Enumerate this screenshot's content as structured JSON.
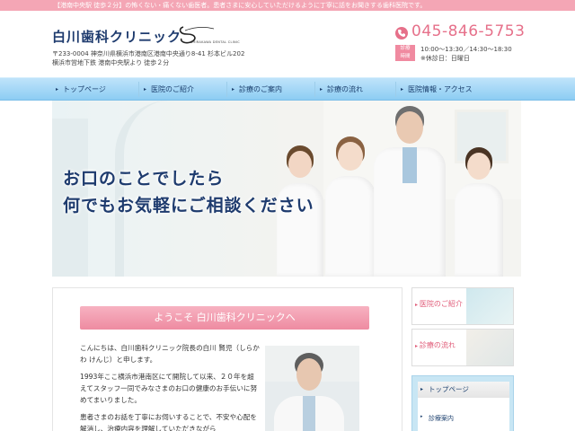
{
  "top_banner": "【港南中央駅 徒歩２分】の怖くない・痛くない歯医者。患者さまに安心していただけるように丁寧に話をお聞きする歯科医院です。",
  "header": {
    "clinic_name": "白川歯科クリニック",
    "logo_subtext": "SHIRAKAWA DENTAL CLINIC",
    "address_line1": "〒233-0004 神奈川県横浜市港南区港南中央通り8-41 杉本ビル202",
    "address_line2": "横浜市営地下鉄 港南中央駅より 徒歩２分",
    "phone": "045-846-5753",
    "hours_badge": "診療\n時間",
    "hours_line1": "10:00～13:30／14:30～18:30",
    "hours_line2": "※休診日：日曜日"
  },
  "nav": {
    "items": [
      {
        "label": "トップページ"
      },
      {
        "label": "医院のご紹介"
      },
      {
        "label": "診療のご案内"
      },
      {
        "label": "診療の流れ"
      },
      {
        "label": "医院情報・アクセス"
      }
    ]
  },
  "hero": {
    "line1": "お口のことでしたら",
    "line2": "何でもお気軽にご相談ください"
  },
  "content": {
    "welcome_heading": "ようこそ 白川歯科クリニックへ",
    "paragraph1": "こんにちは、白川歯科クリニック院長の白川 賢児（しらかわ けんじ）と申します。",
    "paragraph2": "1993年ここ横浜市港南区にて開院して以来、２０年を超えてスタッフ一同でみなさまのお口の健康のお手伝いに努めてまいりました。",
    "paragraph3": "患者さまのお話を丁寧にお伺いすることで、不安や心配を解消し、治療内容を理解していただきながら"
  },
  "sidebar": {
    "card1_label": "医院のご紹介",
    "card2_label": "診療の流れ",
    "menu_head": "トップページ",
    "menu_link": "診療案内"
  },
  "colors": {
    "brand_navy": "#1e3b6e",
    "accent_pink": "#e6708a",
    "nav_blue": "#8dcdf3"
  }
}
